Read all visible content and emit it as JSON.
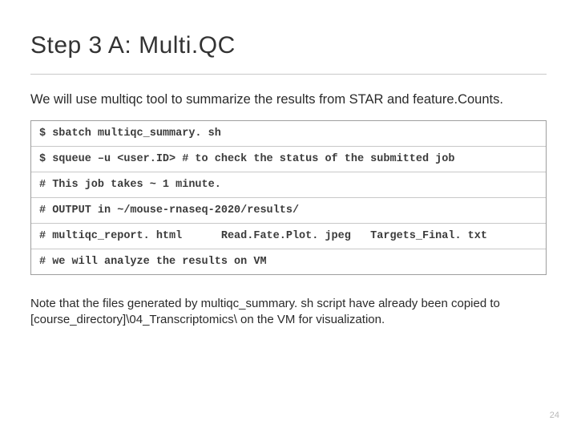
{
  "title": "Step 3 A: Multi.QC",
  "intro": "We will use multiqc tool to summarize the results from STAR and feature.Counts.",
  "code": {
    "line1": "$ sbatch multiqc_summary. sh",
    "line2": "$ squeue –u <user.ID> # to check the status of the submitted job",
    "line3": "# This job takes ~ 1 minute.",
    "line4": "# OUTPUT in ~/mouse-rnaseq-2020/results/",
    "line5": "# multiqc_report. html      Read.Fate.Plot. jpeg   Targets_Final. txt",
    "line6": "# we will analyze the results on VM"
  },
  "note_pre": "Note that the files generated by multiqc_summary. sh script have already been copied to ",
  "note_path": "[course_directory]\\04_Transcriptomics\\",
  "note_post": " on the VM  for visualization.",
  "page_number": "24"
}
